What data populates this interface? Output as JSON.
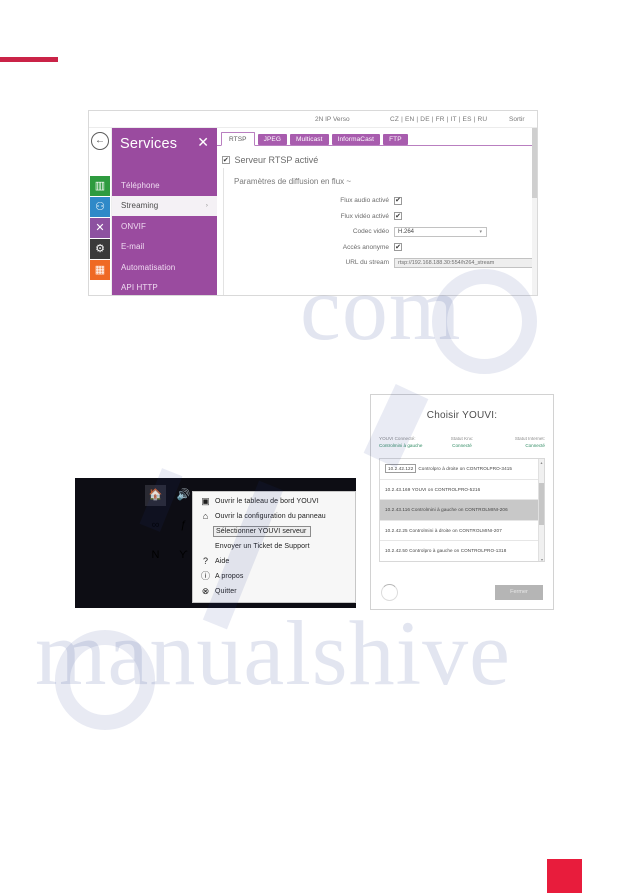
{
  "figure_web_ui": {
    "topbar": {
      "device": "2N IP Verso",
      "languages": "CZ | EN | DE | FR | IT | ES | RU",
      "logout": "Sortir"
    },
    "sidebar": {
      "back_icon": "back-arrow-icon",
      "title": "Services",
      "tool_icon": "tools-icon",
      "rail_icons": [
        {
          "name": "status-bar-chart-icon",
          "glyph": "▥",
          "color": "#2e9b3f"
        },
        {
          "name": "directory-people-icon",
          "glyph": "⚇",
          "color": "#2f89c8"
        },
        {
          "name": "hardware-tools-icon",
          "glyph": "✂",
          "color": "#8d51a0"
        },
        {
          "name": "settings-gear-icon",
          "glyph": "⚙",
          "color": "#3a3a3a"
        },
        {
          "name": "services-grid-icon",
          "glyph": "▦",
          "color": "#ef6924"
        }
      ],
      "items": [
        {
          "label": "Téléphone",
          "active": false
        },
        {
          "label": "Streaming",
          "active": true
        },
        {
          "label": "ONVIF",
          "active": false
        },
        {
          "label": "E-mail",
          "active": false
        },
        {
          "label": "Automatisation",
          "active": false
        },
        {
          "label": "API HTTP",
          "active": false
        }
      ]
    },
    "tabs": [
      {
        "label": "RTSP",
        "active": true
      },
      {
        "label": "JPEG",
        "active": false
      },
      {
        "label": "Multicast",
        "active": false
      },
      {
        "label": "InformaCast",
        "active": false
      },
      {
        "label": "FTP",
        "active": false
      }
    ],
    "panel": {
      "server_enabled_label": "Serveur RTSP activé",
      "server_enabled_checked": "✔",
      "section_title": "Paramètres de diffusion en flux ~",
      "fields": [
        {
          "label": "Flux audio activé",
          "type": "checkbox",
          "value": "✔"
        },
        {
          "label": "Flux vidéo activé",
          "type": "checkbox",
          "value": "✔"
        },
        {
          "label": "Codec vidéo",
          "type": "select",
          "value": "H.264"
        },
        {
          "label": "Accès anonyme",
          "type": "checkbox",
          "value": "✔"
        },
        {
          "label": "URL du stream",
          "type": "text",
          "value": "rtsp://192.168.188.30:554/h264_stream"
        }
      ]
    }
  },
  "figure_tray_menu": {
    "tray_icons": [
      {
        "name": "youvi-tray-icon",
        "glyph": "🏠",
        "highlighted": true
      },
      {
        "name": "volume-speaker-icon",
        "glyph": "🔊",
        "highlighted": false
      },
      {
        "name": "link-chain-icon",
        "glyph": "∞",
        "highlighted": false
      },
      {
        "name": "skype-icon",
        "glyph": "ƒ",
        "highlighted": false
      },
      {
        "name": "onenote-icon",
        "glyph": "N",
        "highlighted": false
      },
      {
        "name": "yammer-icon",
        "glyph": "Ƴ",
        "highlighted": false
      }
    ],
    "menu_items": [
      {
        "icon": "youvi-dashboard-icon",
        "glyph": "▣",
        "label": "Ouvrir le tableau de bord YOUVI",
        "selected": false
      },
      {
        "icon": "youvi-panel-icon",
        "glyph": "⌂",
        "label": "Ouvrir la configuration du panneau",
        "selected": false
      },
      {
        "icon": "blank-icon",
        "glyph": "",
        "label": "Sélectionner YOUVI serveur",
        "selected": true
      },
      {
        "icon": "blank-icon",
        "glyph": "",
        "label": "Envoyer un Ticket de Support",
        "selected": false
      },
      {
        "icon": "help-question-icon",
        "glyph": "?",
        "label": "Aide",
        "selected": false
      },
      {
        "icon": "about-info-icon",
        "glyph": "ⓘ",
        "label": "A propos",
        "selected": false
      },
      {
        "icon": "quit-close-icon",
        "glyph": "⊗",
        "label": "Quitter",
        "selected": false
      }
    ]
  },
  "figure_youvi_dialog": {
    "title": "Choisir YOUVI:",
    "status": [
      {
        "label": "YOUVI Connecté:",
        "value": "Controlmini à gauche"
      },
      {
        "label": "Statut Knx:",
        "value": "Connecté"
      },
      {
        "label": "Statut Internet:",
        "value": "Connecté"
      }
    ],
    "list": [
      {
        "ip": "10.2.42.122",
        "text": "Controlpro à droite on CONTROLPRO-3415",
        "highlighted": false,
        "boxed_ip": true
      },
      {
        "ip": "10.2.43.169",
        "text": "YOUVI on CONTROLPRO-5216",
        "highlighted": false,
        "boxed_ip": false
      },
      {
        "ip": "10.2.43.116",
        "text": "Controlmini à gauche on CONTROLMINI-206",
        "highlighted": true,
        "boxed_ip": false
      },
      {
        "ip": "10.2.42.25",
        "text": "Controlmini à droite on CONTROLMINI-207",
        "highlighted": false,
        "boxed_ip": false
      },
      {
        "ip": "10.2.42.50",
        "text": "Controlpro à gauche on CONTROLPRO-1318",
        "highlighted": false,
        "boxed_ip": false
      }
    ],
    "scroll_up_icon": "caret-up-icon",
    "scroll_down_icon": "caret-down-icon",
    "spinner_icon": "loading-spinner-icon",
    "close_button": "Fermer"
  },
  "watermark": {
    "line1": "manualshive",
    "line2": "com",
    "accent_color": "#2a3f8f"
  },
  "page_marks": {
    "top_rule_color": "#ca2347",
    "bottom_square_color": "#e81c3c"
  }
}
